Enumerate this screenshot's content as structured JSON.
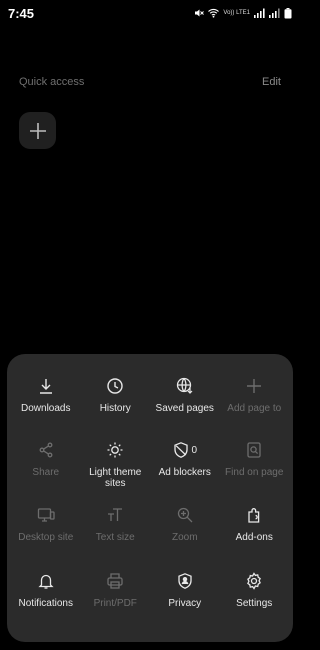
{
  "status_bar": {
    "time": "7:45",
    "network_label": "Vo)) LTE1"
  },
  "quick_access": {
    "title": "Quick access",
    "edit_label": "Edit",
    "add_icon": "plus-icon"
  },
  "menu": {
    "items": [
      {
        "label": "Downloads",
        "icon": "download-icon",
        "enabled": true
      },
      {
        "label": "History",
        "icon": "clock-icon",
        "enabled": true
      },
      {
        "label": "Saved pages",
        "icon": "globe-download-icon",
        "enabled": true
      },
      {
        "label": "Add page to",
        "icon": "plus-icon",
        "enabled": false
      },
      {
        "label": "Share",
        "icon": "share-icon",
        "enabled": false
      },
      {
        "label": "Light theme sites",
        "icon": "sun-icon",
        "enabled": true
      },
      {
        "label": "Ad blockers",
        "icon": "shield-slash-icon",
        "enabled": true,
        "badge": "0"
      },
      {
        "label": "Find on page",
        "icon": "find-page-icon",
        "enabled": false
      },
      {
        "label": "Desktop site",
        "icon": "desktop-icon",
        "enabled": false
      },
      {
        "label": "Text size",
        "icon": "text-size-icon",
        "enabled": false
      },
      {
        "label": "Zoom",
        "icon": "zoom-in-icon",
        "enabled": false
      },
      {
        "label": "Add-ons",
        "icon": "puzzle-icon",
        "enabled": true
      },
      {
        "label": "Notifications",
        "icon": "bell-icon",
        "enabled": true
      },
      {
        "label": "Print/PDF",
        "icon": "printer-icon",
        "enabled": false
      },
      {
        "label": "Privacy",
        "icon": "privacy-shield-icon",
        "enabled": true
      },
      {
        "label": "Settings",
        "icon": "gear-icon",
        "enabled": true
      }
    ]
  },
  "colors": {
    "background": "#000000",
    "panel": "#2b2b2b",
    "enabled_text": "#e8e8e8",
    "disabled_text": "#6d6d6d"
  }
}
